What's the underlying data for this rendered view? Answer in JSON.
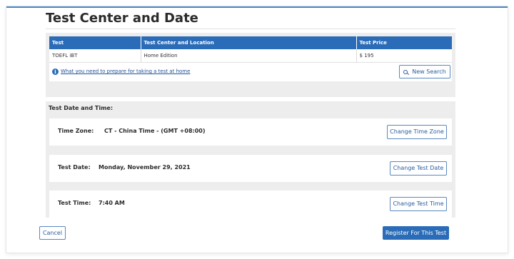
{
  "page": {
    "title": "Test Center and Date"
  },
  "test_center": {
    "columns": [
      "Test",
      "Test Center and Location",
      "Test Price"
    ],
    "rows": [
      [
        "TOEFL iBT",
        "Home Edition",
        "$ 195"
      ]
    ],
    "info_link": "What you need to prepare for taking a test at home",
    "new_search_label": "New Search"
  },
  "date_time": {
    "heading": "Test Date and Time:",
    "time_zone": {
      "label": "Time Zone:",
      "value": "CT - China Time - (GMT +08:00)",
      "button": "Change Time Zone"
    },
    "test_date": {
      "label": "Test Date:",
      "value": "Monday, November 29, 2021",
      "button": "Change Test Date"
    },
    "test_time": {
      "label": "Test Time:",
      "value": "7:40 AM",
      "button": "Change Test Time"
    }
  },
  "actions": {
    "cancel": "Cancel",
    "register": "Register For This Test"
  },
  "colors": {
    "accent": "#2b6cb8",
    "panel": "#ededed"
  },
  "icons": {
    "info": "info-icon",
    "search": "search-icon"
  }
}
